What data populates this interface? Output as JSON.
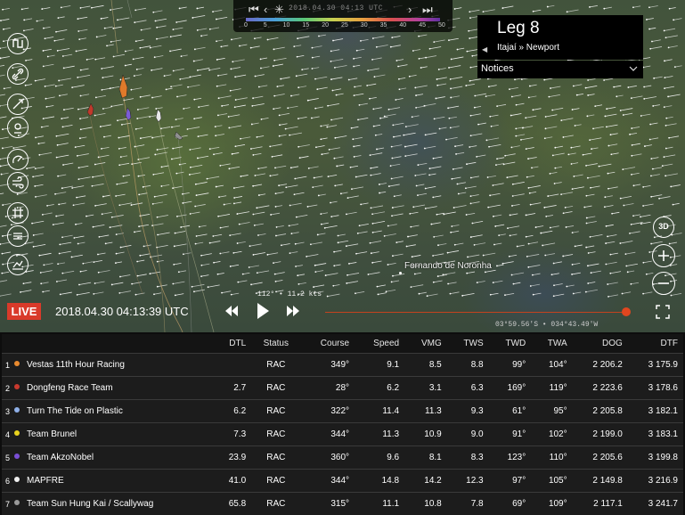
{
  "header": {
    "leg_title": "Leg 8",
    "leg_route": "Itajaí » Newport",
    "notices_label": "Notices",
    "timeline_date": "2018.04.30 04:13 UTC",
    "scale_ticks": [
      "0",
      "5",
      "10",
      "15",
      "20",
      "25",
      "30",
      "35",
      "40",
      "45",
      "50"
    ]
  },
  "map": {
    "place_label": "Fernando de Noronha",
    "wind_readout": "112° • 11.2 kts",
    "coordinates": "03°59.56'S • 034°43.49'W",
    "boat_colors": [
      "#e07a2a",
      "#c0392b",
      "#7b5cd6",
      "#e8e8e8",
      "#8f8f8f"
    ]
  },
  "tools": {
    "left": [
      "route-icon",
      "link-icon",
      "compass-icon",
      "waypoint-icon",
      "speed-icon",
      "wind-icon",
      "grid-icon",
      "layers-icon",
      "chart-icon"
    ],
    "right": [
      "3D",
      "zoom-in-icon",
      "zoom-out-icon"
    ],
    "view_3d_label": "3D"
  },
  "playback": {
    "live_label": "LIVE",
    "clock": "2018.04.30 04:13:39 UTC",
    "progress": 0.98
  },
  "table": {
    "columns": [
      "",
      "",
      "DTL",
      "Status",
      "Course",
      "Speed",
      "VMG",
      "TWS",
      "TWD",
      "TWA",
      "DOG",
      "DTF"
    ],
    "rows": [
      {
        "rank": "1",
        "color": "#e98a2f",
        "name": "Vestas 11th Hour Racing",
        "dtl": "",
        "status": "RAC",
        "course": "349°",
        "speed": "9.1",
        "vmg": "8.5",
        "tws": "8.8",
        "twd": "99°",
        "twa": "104°",
        "dog": "2 206.2",
        "dtf": "3 175.9"
      },
      {
        "rank": "2",
        "color": "#c9392e",
        "name": "Dongfeng Race Team",
        "dtl": "2.7",
        "status": "RAC",
        "course": "28°",
        "speed": "6.2",
        "vmg": "3.1",
        "tws": "6.3",
        "twd": "169°",
        "twa": "119°",
        "dog": "2 223.6",
        "dtf": "3 178.6"
      },
      {
        "rank": "3",
        "color": "#8fb0e8",
        "name": "Turn The Tide on Plastic",
        "dtl": "6.2",
        "status": "RAC",
        "course": "322°",
        "speed": "11.4",
        "vmg": "11.3",
        "tws": "9.3",
        "twd": "61°",
        "twa": "95°",
        "dog": "2 205.8",
        "dtf": "3 182.1"
      },
      {
        "rank": "4",
        "color": "#e8d21e",
        "name": "Team Brunel",
        "dtl": "7.3",
        "status": "RAC",
        "course": "344°",
        "speed": "11.3",
        "vmg": "10.9",
        "tws": "9.0",
        "twd": "91°",
        "twa": "102°",
        "dog": "2 199.0",
        "dtf": "3 183.1"
      },
      {
        "rank": "5",
        "color": "#7a4fd6",
        "name": "Team AkzoNobel",
        "dtl": "23.9",
        "status": "RAC",
        "course": "360°",
        "speed": "9.6",
        "vmg": "8.1",
        "tws": "8.3",
        "twd": "123°",
        "twa": "110°",
        "dog": "2 205.6",
        "dtf": "3 199.8"
      },
      {
        "rank": "6",
        "color": "#f0f0f0",
        "name": "MAPFRE",
        "dtl": "41.0",
        "status": "RAC",
        "course": "344°",
        "speed": "14.8",
        "vmg": "14.2",
        "tws": "12.3",
        "twd": "97°",
        "twa": "105°",
        "dog": "2 149.8",
        "dtf": "3 216.9"
      },
      {
        "rank": "7",
        "color": "#9a9a9a",
        "name": "Team Sun Hung Kai / Scallywag",
        "dtl": "65.8",
        "status": "RAC",
        "course": "315°",
        "speed": "11.1",
        "vmg": "10.8",
        "tws": "7.8",
        "twd": "69°",
        "twa": "109°",
        "dog": "2 117.1",
        "dtf": "3 241.7"
      }
    ]
  }
}
